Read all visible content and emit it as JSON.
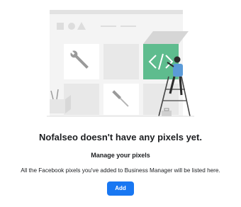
{
  "empty_state": {
    "title": "Nofalseo doesn't have any pixels yet.",
    "subtitle": "Manage your pixels",
    "description": "All the Facebook pixels you've added to Business Manager will be listed here.",
    "add_button_label": "Add",
    "illustration_icon": "code-brackets-icon",
    "colors": {
      "accent": "#1877f2",
      "highlight_tile": "#5ebc8e",
      "tile": "#ececec",
      "panel": "#f4f4f4"
    }
  }
}
